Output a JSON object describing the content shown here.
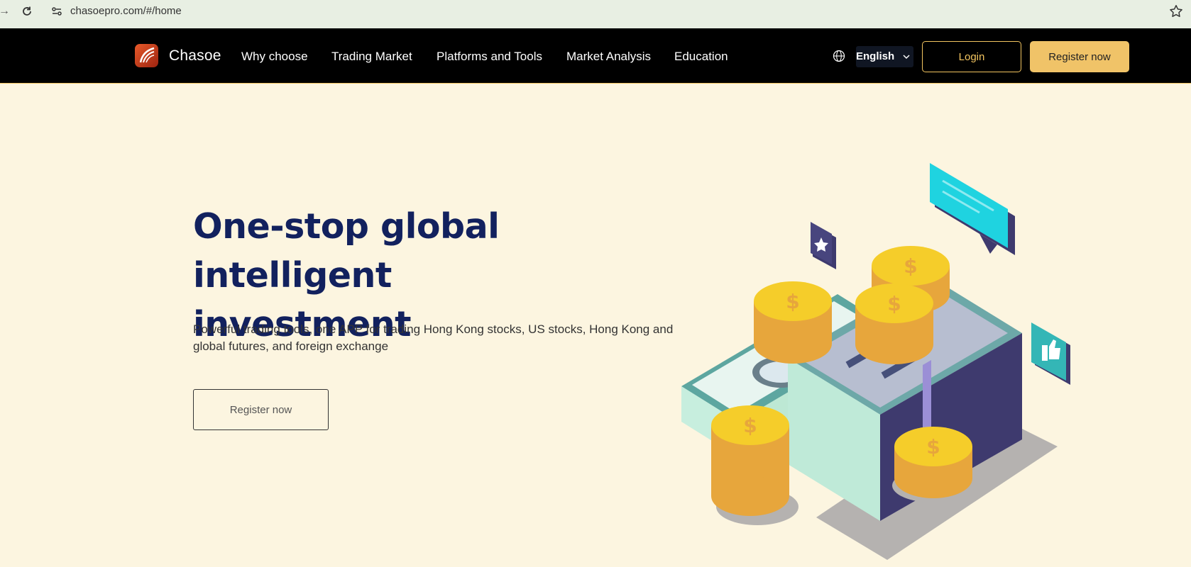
{
  "browser": {
    "url": "chasoepro.com/#/home"
  },
  "site": {
    "brand": "Chasoe",
    "nav": [
      {
        "label": "Why choose"
      },
      {
        "label": "Trading Market"
      },
      {
        "label": "Platforms and Tools"
      },
      {
        "label": "Market Analysis"
      },
      {
        "label": "Education"
      }
    ],
    "language": "English",
    "login_label": "Login",
    "register_label": "Register now"
  },
  "hero": {
    "title_line1": "One-stop global intelligent",
    "title_line2": "investment",
    "subtitle": "Powerful trading tools, one APP for trading Hong Kong stocks, US stocks, Hong Kong and global futures, and foreign exchange",
    "cta_label": "Register now"
  },
  "illustration": {
    "coin_symbol": "$"
  },
  "colors": {
    "background": "#fcf5e0",
    "navbar": "#000000",
    "accent": "#f0c368",
    "title": "#12215e"
  }
}
